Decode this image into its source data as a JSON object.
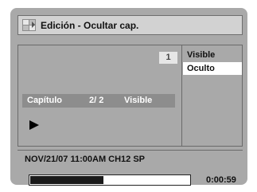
{
  "header": {
    "title": "Edición - Ocultar cap.",
    "icon": "edit-chapters-icon"
  },
  "preview": {
    "chapter_badge": "1",
    "chapter_label": "Capítulo",
    "chapter_count": "2/ 2",
    "chapter_state": "Visible",
    "play_icon": "play-icon"
  },
  "menu": {
    "items": [
      {
        "label": "Visible",
        "selected": false
      },
      {
        "label": "Oculto",
        "selected": true
      }
    ]
  },
  "status": {
    "info": "NOV/21/07 11:00AM CH12 SP",
    "time": "0:00:59",
    "progress_fraction": 0.46
  },
  "colors": {
    "background": "#a9a9a9",
    "chapter_bar": "#8d8d8d",
    "selected_item": "#ffffff",
    "progress_fill": "#1a1a1a"
  }
}
